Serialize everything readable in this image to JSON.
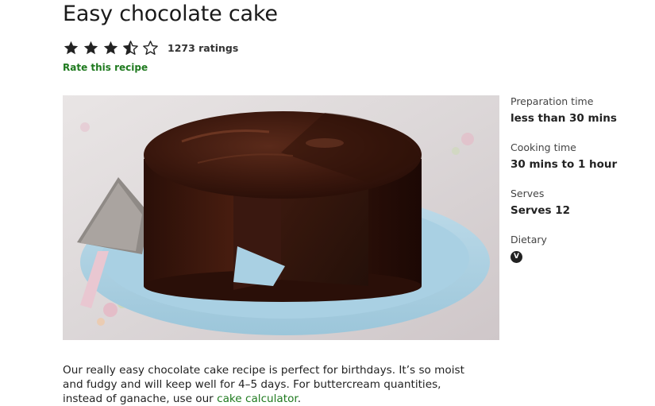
{
  "recipe": {
    "title": "Easy chocolate cake",
    "rating": {
      "value": 3.5,
      "max": 5,
      "count_label": "1273 ratings"
    },
    "rate_link": "Rate this recipe"
  },
  "sidebar": {
    "prep": {
      "label": "Preparation time",
      "value": "less than 30 mins"
    },
    "cook": {
      "label": "Cooking time",
      "value": "30 mins to 1 hour"
    },
    "serves": {
      "label": "Serves",
      "value": "Serves 12"
    },
    "dietary": {
      "label": "Dietary",
      "badge": "V",
      "icon": "vegetarian-icon"
    }
  },
  "description": {
    "text": "Our really easy chocolate cake recipe is perfect for birthdays. It’s so moist and fudgy and will keep well for 4–5 days. For buttercream quantities, instead of ganache, use our ",
    "link": "cake calculator",
    "end": "."
  },
  "colors": {
    "link": "#1f7a1f",
    "star": "#222222"
  }
}
